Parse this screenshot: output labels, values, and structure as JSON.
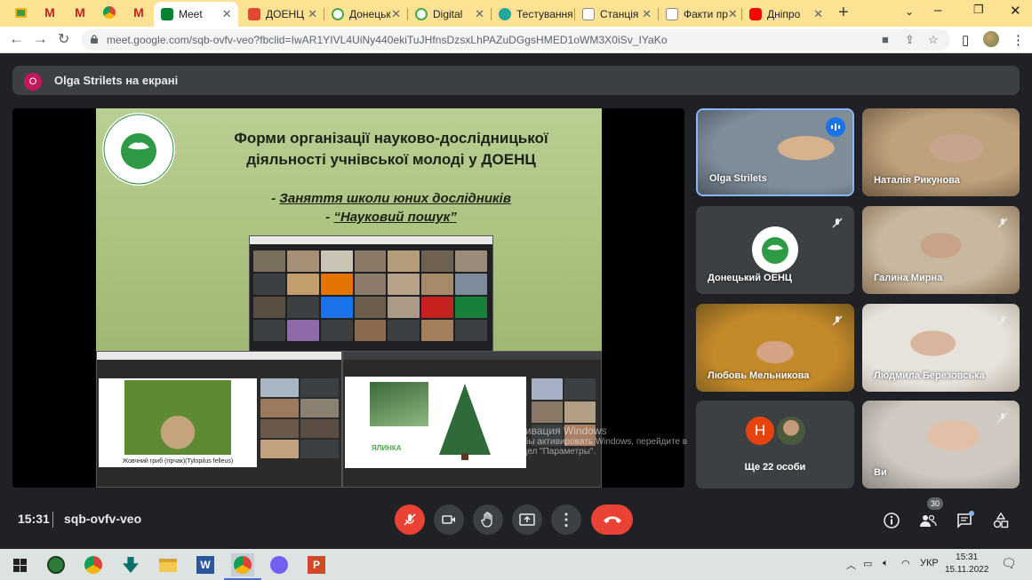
{
  "browser": {
    "tabs": [
      {
        "title": "Meet",
        "active": true
      },
      {
        "title": "ДОЕНЦ"
      },
      {
        "title": "Донецьк"
      },
      {
        "title": "Digital"
      },
      {
        "title": "Тестування"
      },
      {
        "title": "Станція"
      },
      {
        "title": "Факти пр"
      },
      {
        "title": "Дніпро"
      }
    ],
    "url": "meet.google.com/sqb-ovfv-veo?fbclid=IwAR1YIVL4UiNy440ekiTuJHfnsDzsxLhPAZuDGgsHMED1oWM3X0iSv_IYaKo"
  },
  "meet": {
    "presenting_banner": "Olga Strilets на екрані",
    "presenter_initial": "O",
    "slide": {
      "title_line1": "Форми організації науково-дослідницької",
      "title_line2": "діяльності учнівської молоді у ДОЕНЦ",
      "item1": "Заняття школи юних дослідників",
      "item2": "“Науковий пошук”",
      "sub_caption": "Жовчний гриб (гірчак)(Tylopilus felleus)",
      "sub_label": "ЯЛИНКА"
    },
    "participants": [
      {
        "name": "Olga Strilets",
        "speaking": true
      },
      {
        "name": "Наталія Рикунова"
      },
      {
        "name": "Донецький ОЕНЦ",
        "muted": true
      },
      {
        "name": "Галина Мирна",
        "muted": true
      },
      {
        "name": "Любовь Мельникова",
        "muted": true
      },
      {
        "name": "Людмила Березовська",
        "muted": true
      },
      {
        "name": "Ще 22 особи",
        "initial": "Н"
      },
      {
        "name": "Ви",
        "muted": true
      }
    ],
    "watermark_line1": "Активация Windows",
    "watermark_line2": "Чтобы активировать Windows, перейдите в",
    "watermark_line3": "раздел \"Параметры\".",
    "time": "15:31",
    "meeting_code": "sqb-ovfv-veo",
    "people_count": "30"
  },
  "taskbar": {
    "lang": "УКР",
    "time": "15:31",
    "date": "15.11.2022"
  },
  "colors": {
    "chrome_tabbar": "#fde293",
    "meet_bg": "#202124",
    "end_call": "#ea4335",
    "accent_blue": "#8ab4f8"
  }
}
